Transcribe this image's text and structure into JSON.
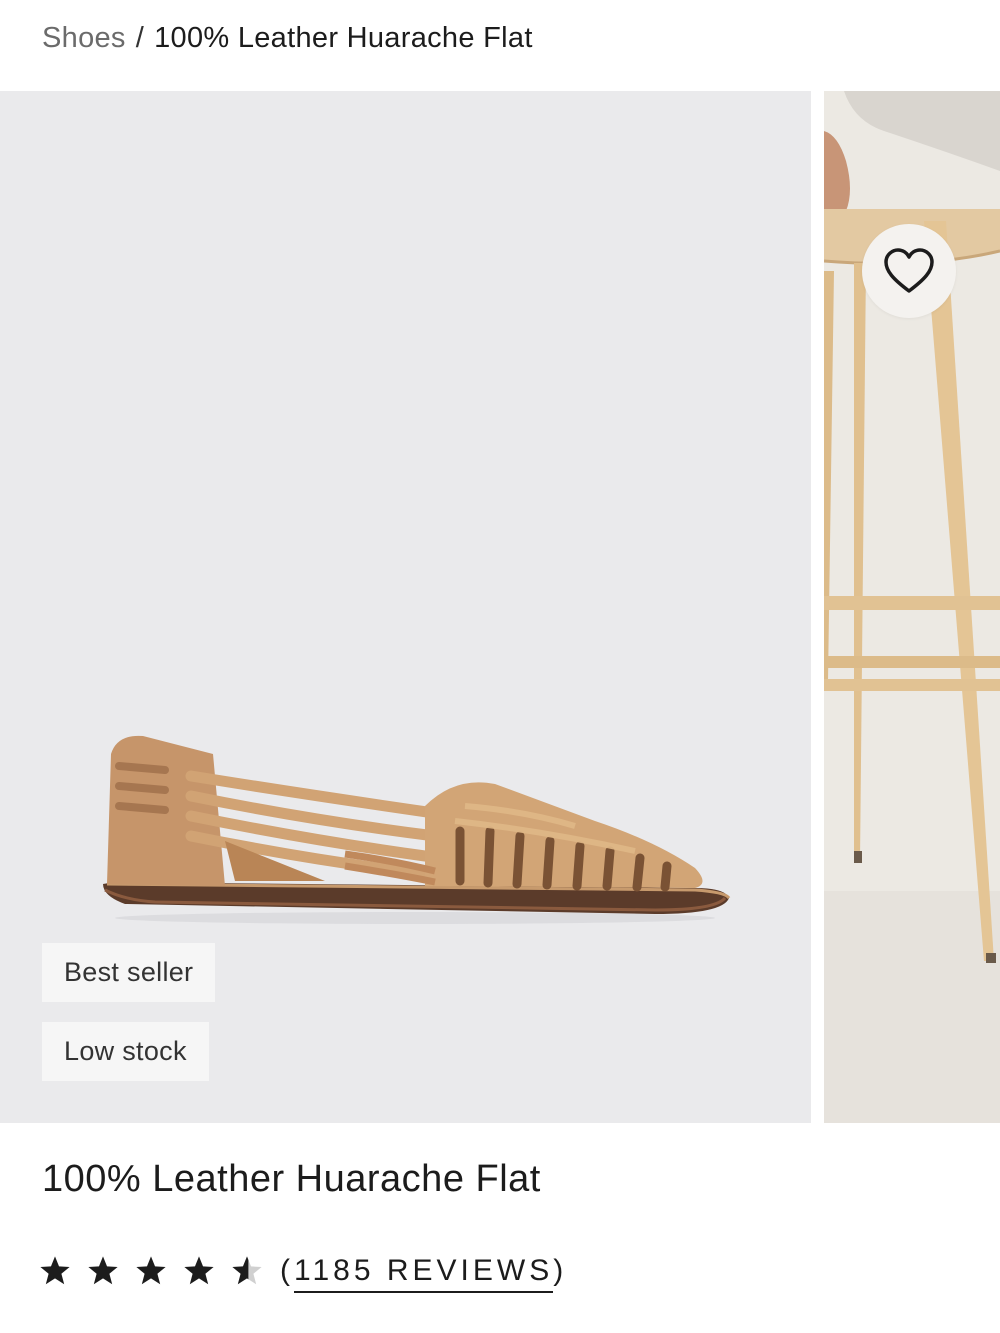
{
  "breadcrumb": {
    "parent": "Shoes",
    "separator": "/",
    "current": "100% Leather Huarache Flat"
  },
  "gallery": {
    "badges": [
      "Best seller",
      "Low stock"
    ],
    "favorite_icon": "heart-icon"
  },
  "product": {
    "title": "100% Leather Huarache Flat",
    "rating": 4.5,
    "rating_max": 5,
    "reviews_open": "(",
    "reviews_text": "1185 REVIEWS",
    "reviews_close": ")"
  },
  "colors": {
    "main_bg": "#eaeaec",
    "badge_bg": "#f6f6f6",
    "leather": "#c99a6b",
    "text": "#1c1c1c"
  }
}
